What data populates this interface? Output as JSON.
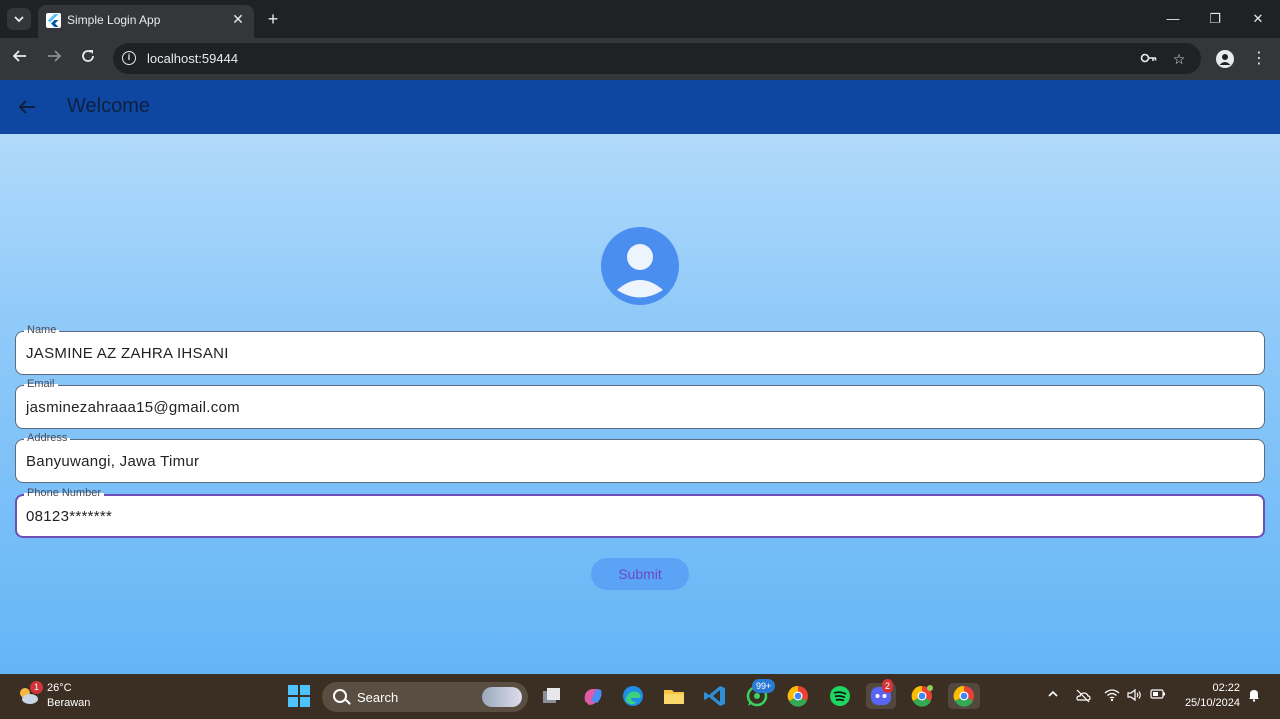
{
  "browser": {
    "tab_title": "Simple Login App",
    "url": "localhost:59444"
  },
  "app": {
    "title": "Welcome",
    "fields": [
      {
        "label": "Name",
        "value": "JASMINE AZ ZAHRA IHSANI"
      },
      {
        "label": "Email",
        "value": "jasminezahraaa15@gmail.com"
      },
      {
        "label": "Address",
        "value": "Banyuwangi, Jawa Timur"
      },
      {
        "label": "Phone Number",
        "value": "08123*******"
      }
    ],
    "submit_label": "Submit",
    "colors": {
      "appbar": "#0d47a1",
      "avatar": "#4a8ef0",
      "focus_border": "#6e4fb5",
      "submit_bg": "#5ba3f5"
    }
  },
  "taskbar": {
    "weather_temp": "26°C",
    "weather_desc": "Berawan",
    "weather_badge": "1",
    "search_placeholder": "Search",
    "whatsapp_badge": "99+",
    "discord_badge": "2",
    "time": "02:22",
    "date": "25/10/2024"
  }
}
